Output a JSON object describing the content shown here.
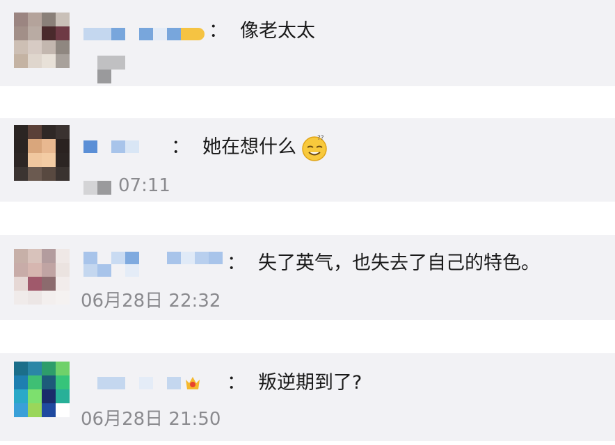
{
  "comments": [
    {
      "text": "像老太太",
      "time": ""
    },
    {
      "text": "她在想什么",
      "time": "07:11",
      "emoji": "thinking-emoji"
    },
    {
      "text": "失了英气，也失去了自己的特色。",
      "time": "06月28日 22:32"
    },
    {
      "text": "叛逆期到了?",
      "time": "06月28日 21:50"
    }
  ],
  "separator": "："
}
